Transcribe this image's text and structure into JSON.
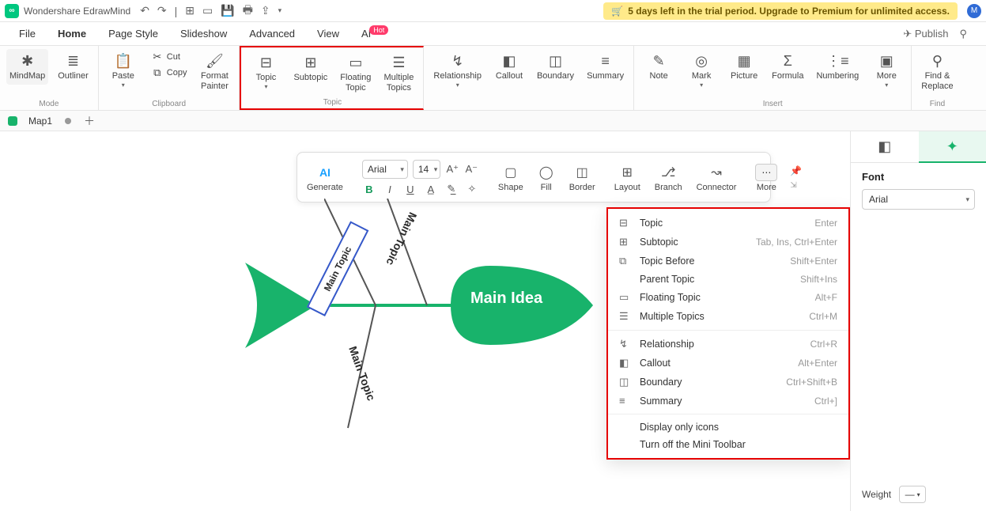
{
  "titlebar": {
    "app_name": "Wondershare EdrawMind",
    "trial_banner": "5 days left in the trial period. Upgrade to Premium for unlimited access.",
    "avatar_initial": "M"
  },
  "menu": {
    "file": "File",
    "home": "Home",
    "page_style": "Page Style",
    "slideshow": "Slideshow",
    "advanced": "Advanced",
    "view": "View",
    "ai": "AI",
    "ai_badge": "Hot",
    "publish": "Publish"
  },
  "ribbon": {
    "mode": {
      "mindmap": "MindMap",
      "outliner": "Outliner",
      "label": "Mode"
    },
    "clipboard": {
      "paste": "Paste",
      "cut": "Cut",
      "copy": "Copy",
      "format_painter_l1": "Format",
      "format_painter_l2": "Painter",
      "label": "Clipboard"
    },
    "topic": {
      "topic": "Topic",
      "subtopic": "Subtopic",
      "floating_l1": "Floating",
      "floating_l2": "Topic",
      "multiple_l1": "Multiple",
      "multiple_l2": "Topics",
      "label": "Topic"
    },
    "extras": {
      "relationship": "Relationship",
      "callout": "Callout",
      "boundary": "Boundary",
      "summary": "Summary"
    },
    "insert": {
      "note": "Note",
      "mark": "Mark",
      "picture": "Picture",
      "formula": "Formula",
      "numbering": "Numbering",
      "more": "More",
      "label": "Insert"
    },
    "find": {
      "find_l1": "Find &",
      "find_l2": "Replace",
      "label": "Find"
    }
  },
  "tabs": {
    "map1": "Map1"
  },
  "mini_toolbar": {
    "ai": "AI",
    "generate": "Generate",
    "font_name": "Arial",
    "font_size": "14",
    "shape": "Shape",
    "fill": "Fill",
    "border": "Border",
    "layout": "Layout",
    "branch": "Branch",
    "connector": "Connector",
    "more": "More"
  },
  "canvas": {
    "main_idea": "Main Idea",
    "main_topic": "Main Topic"
  },
  "context_menu": {
    "topic": {
      "label": "Topic",
      "shortcut": "Enter"
    },
    "subtopic": {
      "label": "Subtopic",
      "shortcut": "Tab, Ins, Ctrl+Enter"
    },
    "topic_before": {
      "label": "Topic Before",
      "shortcut": "Shift+Enter"
    },
    "parent_topic": {
      "label": "Parent Topic",
      "shortcut": "Shift+Ins"
    },
    "floating": {
      "label": "Floating Topic",
      "shortcut": "Alt+F"
    },
    "multiple": {
      "label": "Multiple Topics",
      "shortcut": "Ctrl+M"
    },
    "relationship": {
      "label": "Relationship",
      "shortcut": "Ctrl+R"
    },
    "callout": {
      "label": "Callout",
      "shortcut": "Alt+Enter"
    },
    "boundary": {
      "label": "Boundary",
      "shortcut": "Ctrl+Shift+B"
    },
    "summary": {
      "label": "Summary",
      "shortcut": "Ctrl+]"
    },
    "display_icons": "Display only icons",
    "turn_off": "Turn off the Mini Toolbar"
  },
  "right_panel": {
    "font_label": "Font",
    "font_name": "Arial",
    "weight_label": "Weight"
  }
}
